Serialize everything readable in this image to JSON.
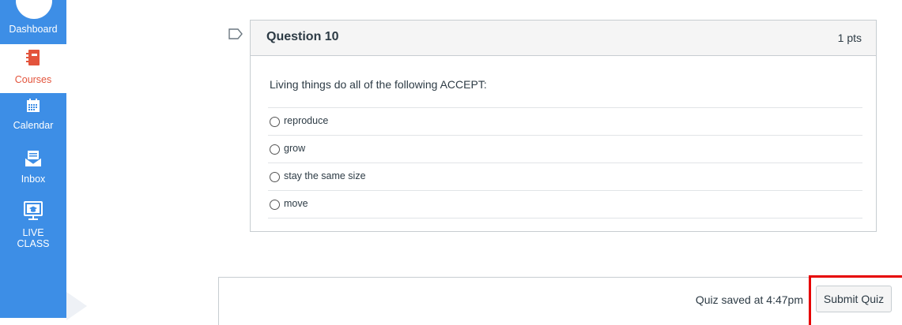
{
  "sidebar": {
    "items": [
      {
        "label": "Dashboard",
        "icon": "dashboard-icon"
      },
      {
        "label": "Courses",
        "icon": "courses-icon",
        "active": true
      },
      {
        "label": "Calendar",
        "icon": "calendar-icon"
      },
      {
        "label": "Inbox",
        "icon": "inbox-icon"
      },
      {
        "label": "LIVE\nCLASS",
        "icon": "live-class-icon"
      }
    ],
    "bg_color": "#3d8ee6",
    "active_color": "#e3543c"
  },
  "question": {
    "title": "Question 10",
    "points": "1 pts",
    "text": "Living things do all of the following ACCEPT:",
    "answers": [
      "reproduce",
      "grow",
      "stay the same size",
      "move"
    ]
  },
  "footer": {
    "saved_text": "Quiz saved at 4:47pm",
    "submit_label": "Submit Quiz",
    "highlight_color": "#e60000"
  }
}
